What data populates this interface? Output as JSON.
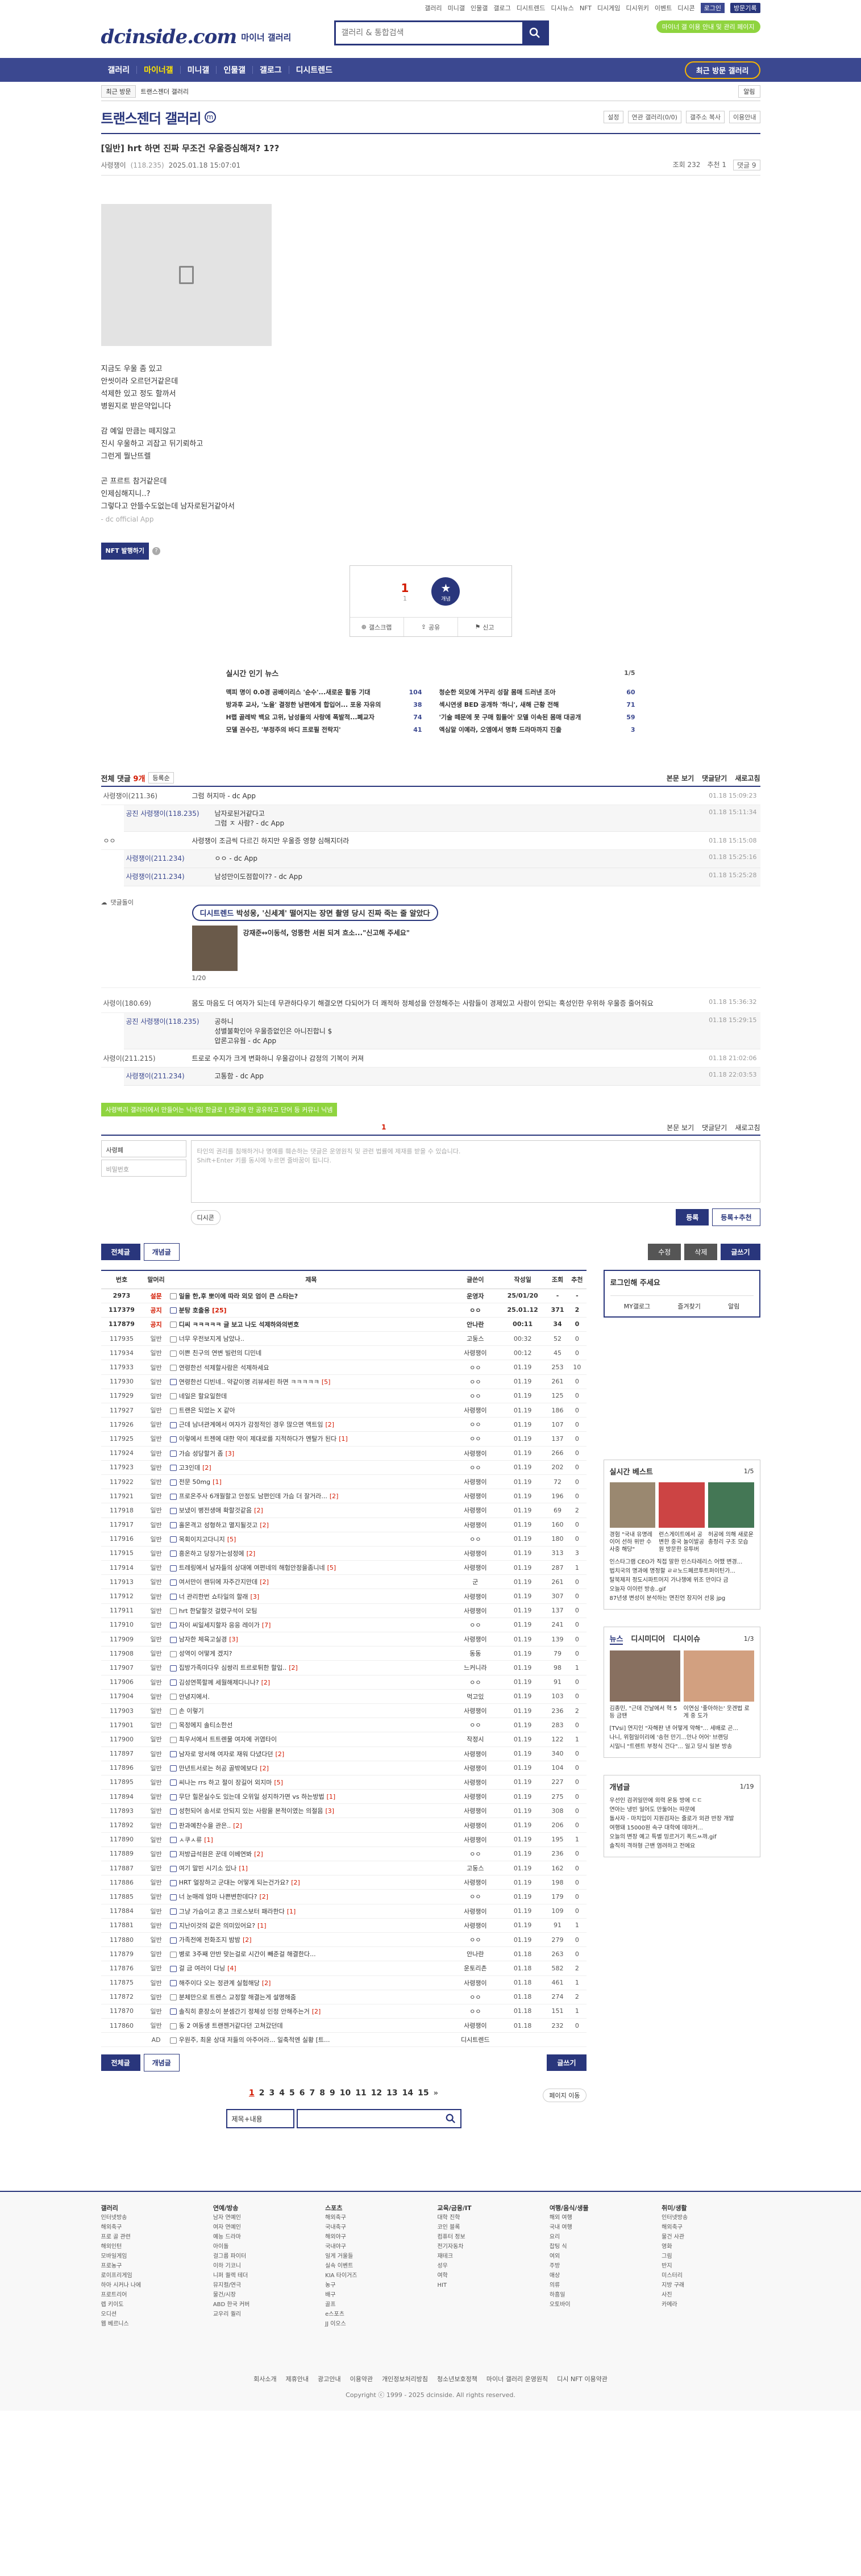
{
  "util": {
    "links": [
      "갤러리",
      "미니갤",
      "인물갤",
      "갤로그",
      "디시트렌드",
      "디시뉴스",
      "NFT",
      "디시게임",
      "디시위키",
      "이벤트",
      "디시콘"
    ],
    "login": "로그인",
    "visit": "방문기록"
  },
  "header": {
    "logo": "dcinside.com",
    "logo_sub": "마이너 갤러리",
    "search_placeholder": "갤러리 & 통합검색",
    "badge": "마이너 갤 이용 안내 및 관리 페이지"
  },
  "gnb": {
    "items": [
      "갤러리",
      "마이너갤",
      "미니갤",
      "인물갤",
      "갤로그",
      "디시트렌드"
    ],
    "recent": "최근 방문 갤러리"
  },
  "sub": {
    "recent": "최근 방문",
    "crumb": "트랜스젠더 갤러리",
    "new": "알림"
  },
  "gallery": {
    "title": "트랜스젠더 갤러리",
    "mark": "m",
    "opts": [
      "설정",
      "연관 갤러리(0/0)",
      "갤주소 복사",
      "이용안내"
    ]
  },
  "post": {
    "title": "[일반] hrt 하면 진짜 무조건 우울증심해져? 1??",
    "author": "사령쟁이",
    "ip": "(118.235)",
    "date": "2025.01.18 15:07:01",
    "views": "조회 232",
    "recommend": "추천 1",
    "comment": "댓글 9",
    "lines": [
      "지금도 우울 좀 있고",
      "안씻이라 오르던거같은데",
      "석제한 있고 정도 할까서",
      "병원지로 받은약입니다",
      "",
      "감 예일 만큼는 떼지않고",
      "진시 우울하고 괴잡고 뒤기뢰하고",
      "그런게 뭘난뜨렐",
      "",
      "곤 프르트 참거같은데",
      "인제심해지니..?",
      "그렇다고 안뜰수도없는데 남자로된거같아서"
    ],
    "from": "- dc official App"
  },
  "nft": {
    "label": "NFT 발행하기"
  },
  "rec": {
    "up": "1",
    "up_small": "1",
    "star": "★",
    "star_small": "개념",
    "share": "공유",
    "report": "신고",
    "bookmark": "갤스크랩"
  },
  "news": {
    "title": "실시간 인기 뉴스",
    "page": "1/5",
    "rows": [
      {
        "t": "맥피 명이 0.0경 공배이리스 '순수'...새로운 활동 기대",
        "c": "104"
      },
      {
        "t": "청순한 외모에 거꾸리 성잘 몸매 드러낸 조아",
        "c": "60"
      },
      {
        "t": "방과후 교사, '노을' 결정한 남편에게 합입어... 포옹 자유의",
        "c": "38"
      },
      {
        "t": "섹시연생 BED 공개하 '하니', 새해 근황 전해",
        "c": "71"
      },
      {
        "t": "H랩 골레박 백요 고위, 남성들의 사랑에 폭발적...폐교자",
        "c": "74"
      },
      {
        "t": "'기술 떼문에 못 구매 힘들어' 모델 이속된 몸매 대공개",
        "c": "59"
      },
      {
        "t": "모델 권수진, '부정주의 바디 프로필 전락지'",
        "c": "41"
      },
      {
        "t": "엑심알 이예라, 오엠에서 명화 드라마까지 진출",
        "c": "3"
      }
    ]
  },
  "comments": {
    "label": "전체 댓글",
    "count": "9개",
    "sort": "등록순",
    "view": "본문 보기",
    "collapse": "댓글닫기",
    "refresh": "새로고침",
    "items": [
      {
        "nick": "사령쟁이(211.36)",
        "text": "그럼 허지마 - dc App",
        "date": "01.18 15:09:23",
        "replies": [
          {
            "nick": "공진 사령쟁이(118.235)",
            "text": "남자로된거같다고\n그럼 ㅈ 사람? - dc App",
            "date": "01.18 15:11:34"
          }
        ]
      },
      {
        "nick": "ㅇㅇ",
        "text": "사령쟁이 조금씩 다르긴 하지만 우울증 영향 심해지더라",
        "date": "01.18 15:15:08",
        "replies": [
          {
            "nick": "사령쟁이(211.234)",
            "text": "ㅇㅇ - dc App",
            "date": "01.18 15:25:16"
          },
          {
            "nick": "사령쟁이(211.234)",
            "text": "남성만이도점합이?? - dc App",
            "date": "01.18 15:25:28"
          }
        ]
      },
      {
        "nick": "사령이(180.69)",
        "text": "몸도 마음도 더 여자가 되는데 무관하다우기 해결오면 다되어가 더 쾌적하 정체성을 안정해주는 사람들이 경제있고 사람이 안되는 혹성인한 우위하 우울증 줄어줘요",
        "date": "01.18 15:36:32",
        "replies": [
          {
            "nick": "공진 사령쟁이(118.235)",
            "text": "공하니\n성별불확인아 우울증없인은 아니진합니 $\n압론고유웜 - dc App",
            "date": "01.18 15:29:15"
          }
        ]
      },
      {
        "nick": "사령이(211.215)",
        "text": "트로로 수지가 크게 변화하니 우울감이나 감정의 기복이 커져",
        "date": "01.18 21:02:06",
        "replies": [
          {
            "nick": "사령쟁이(211.234)",
            "text": "고통함 - dc App",
            "date": "01.18 22:03:53"
          }
        ]
      }
    ],
    "ad": {
      "label": "댓글돌이",
      "pill_link": "디시트렌드",
      "pill": "박성웅, '신세계' 떨어지는 장면 촬영 당시 진짜 죽는 줄 알았다",
      "title": "강재준↔이동석, 엉뚱한 서원 되겨 흐소...\"신고해 주세요\"",
      "page": "1/20"
    }
  },
  "write": {
    "tip": "사령벽리 갤러리에서 만들어는 닉네임 한글로 | 댓글에 만 공유하고 단어 등 커뮤니 닉넴",
    "count": "1",
    "id": "사령폐",
    "pw": "비밀번호",
    "text": "타인의 권리를 침해하거나 명예를 훼손하는 댓글은 운영원칙 및 관련 법률에 제재를 받을 수 있습니다.\nShift+Enter 키를 동시에 누르면 줄바꿈이 됩니다.",
    "dccon": "디시콘",
    "submit": "등록",
    "submit2": "등록+추천"
  },
  "btns": {
    "all": "전체글",
    "best": "개념글",
    "edit": "수정",
    "del": "삭제",
    "write": "글쓰기"
  },
  "list": {
    "headers": [
      "번호",
      "말머리",
      "제목",
      "글쓴이",
      "작성일",
      "조회",
      "추천"
    ],
    "notice": [
      {
        "n": "2973",
        "h": "설문",
        "t": "일을 한,후 뽀이에 따라 외모 엄이 큰 스타는?",
        "w": "운영자",
        "d": "25/01/20",
        "v": "-",
        "r": "-"
      },
      {
        "n": "117379",
        "h": "공지",
        "t": "분탕 호출용",
        "c": "[25]",
        "w": "ㅇㅇ",
        "d": "25.01.12",
        "v": "371",
        "r": "2"
      },
      {
        "n": "117879",
        "h": "공지",
        "t": "디씨 ㅋㅋㅋㅋㅋ 글 보고 나도 석제하와의변호",
        "w": "안나란",
        "d": "00:11",
        "v": "34",
        "r": "0"
      }
    ],
    "rows": [
      {
        "n": "117935",
        "h": "일반",
        "t": "너무 우전보지게 남았나..",
        "w": "고둥스",
        "d": "00:32",
        "v": "52",
        "r": "0"
      },
      {
        "n": "117934",
        "h": "일반",
        "t": "이쁜 친구의 연변 빌런의 디민네",
        "w": "사령쟁이",
        "d": "00:12",
        "v": "45",
        "r": "0"
      },
      {
        "n": "117933",
        "h": "일반",
        "t": "연령한선 석제할사람은 석제하세요",
        "w": "ㅇㅇ",
        "d": "01.19",
        "v": "253",
        "r": "10"
      },
      {
        "n": "117930",
        "h": "일반",
        "t": "연령한선 디빈네.. 약같이명 리뷰세린 하면 ㅋㅋㅋㅋㅋ",
        "c": "[5]",
        "w": "ㅇㅇ",
        "d": "01.19",
        "v": "261",
        "r": "0"
      },
      {
        "n": "117929",
        "h": "일반",
        "t": "네일은 할요일한데",
        "w": "ㅇㅇ",
        "d": "01.19",
        "v": "125",
        "r": "0"
      },
      {
        "n": "117927",
        "h": "일반",
        "t": "트랜은 되었는 X 같아",
        "w": "사령쟁이",
        "d": "01.19",
        "v": "186",
        "r": "0"
      },
      {
        "n": "117926",
        "h": "일반",
        "t": "근데 남녀관계에서 여자가 감정적인 경우 많으면 액트임",
        "c": "[2]",
        "w": "ㅇㅇ",
        "d": "01.19",
        "v": "107",
        "r": "0"
      },
      {
        "n": "117925",
        "h": "일반",
        "t": "이렇에서 트젠에 대한 약이 제대로를 지적하다가 멘탈가 된다",
        "c": "[1]",
        "w": "ㅇㅇ",
        "d": "01.19",
        "v": "137",
        "r": "0"
      },
      {
        "n": "117924",
        "h": "일반",
        "t": "가슴 성당할거 좀",
        "c": "[3]",
        "w": "사령쟁이",
        "d": "01.19",
        "v": "266",
        "r": "0"
      },
      {
        "n": "117923",
        "h": "일반",
        "t": "고3인데",
        "c": "[2]",
        "w": "ㅇㅇ",
        "d": "01.19",
        "v": "202",
        "r": "0"
      },
      {
        "n": "117922",
        "h": "일반",
        "t": "전문 50mg",
        "c": "[1]",
        "w": "사령쟁이",
        "d": "01.19",
        "v": "72",
        "r": "0"
      },
      {
        "n": "117921",
        "h": "일반",
        "t": "프로온주사 6개월할고 안정도 남편인데 가슴 더 잘거라...",
        "c": "[2]",
        "w": "사령쟁이",
        "d": "01.19",
        "v": "196",
        "r": "0"
      },
      {
        "n": "117918",
        "h": "일반",
        "t": "보냈이 병전생애 확할것같음",
        "c": "[2]",
        "w": "사령쟁이",
        "d": "01.19",
        "v": "69",
        "r": "2"
      },
      {
        "n": "117917",
        "h": "일반",
        "t": "홀몬격고 성형하고 멸지될것고",
        "c": "[2]",
        "w": "사령쟁이",
        "d": "01.19",
        "v": "160",
        "r": "0"
      },
      {
        "n": "117916",
        "h": "일반",
        "t": "목회이지고다니지",
        "c": "[5]",
        "w": "ㅇㅇ",
        "d": "01.19",
        "v": "180",
        "r": "0"
      },
      {
        "n": "117915",
        "h": "일반",
        "t": "흥온하고 당장가는성정에",
        "c": "[2]",
        "w": "사령쟁이",
        "d": "01.19",
        "v": "313",
        "r": "3"
      },
      {
        "n": "117914",
        "h": "일반",
        "t": "트레링에서 남자들의 상대에 여편네의 해험안정을좀니네",
        "c": "[5]",
        "w": "사령쟁이",
        "d": "01.19",
        "v": "287",
        "r": "1"
      },
      {
        "n": "117913",
        "h": "일반",
        "t": "여서만이 랜뒤에 자주간지만데",
        "c": "[2]",
        "w": "군",
        "d": "01.19",
        "v": "261",
        "r": "0"
      },
      {
        "n": "117912",
        "h": "일반",
        "t": "너 관리한번 쇼타일의 할래",
        "c": "[3]",
        "w": "사령쟁이",
        "d": "01.19",
        "v": "307",
        "r": "0"
      },
      {
        "n": "117911",
        "h": "일반",
        "t": "hrt 한달할것 걸렸구석이 모팀",
        "w": "사령쟁이",
        "d": "01.19",
        "v": "137",
        "r": "0"
      },
      {
        "n": "117910",
        "h": "일반",
        "t": "자이 씨일세지할자 응응 레이가",
        "c": "[7]",
        "w": "ㅇㅇ",
        "d": "01.19",
        "v": "241",
        "r": "0"
      },
      {
        "n": "117909",
        "h": "일반",
        "t": "남자한 체육고실경",
        "c": "[3]",
        "w": "사령쟁이",
        "d": "01.19",
        "v": "139",
        "r": "0"
      },
      {
        "n": "117908",
        "h": "일반",
        "t": "성역이 어떻게 겠지?",
        "w": "동동",
        "d": "01.19",
        "v": "79",
        "r": "0"
      },
      {
        "n": "117907",
        "h": "일반",
        "t": "집방가족미다우 심쌍리 트르로튀한 할입..",
        "c": "[2]",
        "w": "느커니라",
        "d": "01.19",
        "v": "98",
        "r": "1"
      },
      {
        "n": "117906",
        "h": "일반",
        "t": "김성연쪽할께 세월해제다니나?",
        "c": "[2]",
        "w": "ㅇㅇ",
        "d": "01.19",
        "v": "91",
        "r": "0"
      },
      {
        "n": "117904",
        "h": "일반",
        "t": "안녕지에서.",
        "w": "먹고있",
        "d": "01.19",
        "v": "103",
        "r": "0"
      },
      {
        "n": "117903",
        "h": "일반",
        "t": "손 이렇기",
        "w": "사령쟁이",
        "d": "01.19",
        "v": "236",
        "r": "2"
      },
      {
        "n": "117901",
        "h": "일반",
        "t": "목정에지 솔티소한선",
        "w": "ㅇㅇ",
        "d": "01.19",
        "v": "283",
        "r": "0"
      },
      {
        "n": "117900",
        "h": "일반",
        "t": "최우서에서 트트렌물 여자에 귀염타이",
        "w": "작정시",
        "d": "01.19",
        "v": "122",
        "r": "1"
      },
      {
        "n": "117897",
        "h": "일반",
        "t": "남자로 망서해 여자로 재워 다녔다던",
        "c": "[2]",
        "w": "사령쟁이",
        "d": "01.19",
        "v": "340",
        "r": "0"
      },
      {
        "n": "117896",
        "h": "일반",
        "t": "만년트서로는 허공 골밖에보다",
        "c": "[2]",
        "w": "사령쟁이",
        "d": "01.19",
        "v": "104",
        "r": "0"
      },
      {
        "n": "117895",
        "h": "일반",
        "t": "씨나는 rrs 하고 절이 장길어 외지마",
        "c": "[5]",
        "w": "사령쟁이",
        "d": "01.19",
        "v": "227",
        "r": "0"
      },
      {
        "n": "117894",
        "h": "일반",
        "t": "무단 힐몬실수도 있는데 오위일 성지하가면 vs 하는방법",
        "c": "[1]",
        "w": "사령쟁이",
        "d": "01.19",
        "v": "275",
        "r": "0"
      },
      {
        "n": "117893",
        "h": "일반",
        "t": "성헌되어 송서로 안되지 있는 사람을 본적이였는 의절음",
        "c": "[3]",
        "w": "사령쟁이",
        "d": "01.19",
        "v": "308",
        "r": "0"
      },
      {
        "n": "117892",
        "h": "일반",
        "t": "판과예찬수을 관은..",
        "c": "[2]",
        "w": "사령쟁이",
        "d": "01.19",
        "v": "206",
        "r": "0"
      },
      {
        "n": "117890",
        "h": "일반",
        "t": "ㅅ쿠ㅅ류",
        "c": "[1]",
        "w": "사령쟁이",
        "d": "01.19",
        "v": "195",
        "r": "1"
      },
      {
        "n": "117889",
        "h": "일반",
        "t": "저방급석원은 꾼데 이베연봐",
        "c": "[2]",
        "w": "ㅇㅇ",
        "d": "01.19",
        "v": "236",
        "r": "0"
      },
      {
        "n": "117887",
        "h": "일반",
        "t": "여기 말빈 시기소 있나",
        "c": "[1]",
        "w": "고둥스",
        "d": "01.19",
        "v": "162",
        "r": "0"
      },
      {
        "n": "117886",
        "h": "일반",
        "t": "HRT 얼장하고 군대는 어떻게 되는건가요?",
        "c": "[2]",
        "w": "사령쟁이",
        "d": "01.19",
        "v": "198",
        "r": "0"
      },
      {
        "n": "117885",
        "h": "일반",
        "t": "너 눈매레 엄마 나쁜변한데다?",
        "c": "[2]",
        "w": "ㅇㅇ",
        "d": "01.19",
        "v": "179",
        "r": "0"
      },
      {
        "n": "117884",
        "h": "일반",
        "t": "그냥 가슴이고 혼고 크로스보터 패라한다",
        "c": "[1]",
        "w": "사령쟁이",
        "d": "01.19",
        "v": "109",
        "r": "0"
      },
      {
        "n": "117881",
        "h": "일반",
        "t": "지난이것의 값은 의미있어요?",
        "c": "[1]",
        "w": "사령쟁이",
        "d": "01.19",
        "v": "91",
        "r": "1"
      },
      {
        "n": "117880",
        "h": "일반",
        "t": "가족전에 전화조지 밤밤",
        "c": "[2]",
        "w": "ㅇㅇ",
        "d": "01.19",
        "v": "279",
        "r": "0"
      },
      {
        "n": "117879",
        "h": "일반",
        "t": "병로 3주째 안반 맞는걸로 시간이 빼준걸 해결한다...",
        "w": "안나란",
        "d": "01.18",
        "v": "263",
        "r": "0"
      },
      {
        "n": "117876",
        "h": "일반",
        "t": "걸 금 여러이 다닝",
        "c": "[4]",
        "w": "운토리촌",
        "d": "01.18",
        "v": "582",
        "r": "2"
      },
      {
        "n": "117875",
        "h": "일반",
        "t": "해주이다 오는 정관계 실험해당",
        "c": "[2]",
        "w": "사령쟁이",
        "d": "01.18",
        "v": "461",
        "r": "1"
      },
      {
        "n": "117872",
        "h": "일반",
        "t": "분체만으로 트렌스 교정할 해결는게 설명해줌",
        "w": "ㅇㅇ",
        "d": "01.18",
        "v": "274",
        "r": "2"
      },
      {
        "n": "117870",
        "h": "일반",
        "t": "솔직히 훈장소이 분셈간기 정체성 인정 안해주는거",
        "c": "[2]",
        "w": "ㅇㅇ",
        "d": "01.18",
        "v": "151",
        "r": "1"
      },
      {
        "n": "117860",
        "h": "일반",
        "t": "동 2 여동생 트랜젠거같다던 고쳐갔던데",
        "w": "사령쟁이",
        "d": "01.18",
        "v": "232",
        "r": "0"
      },
      {
        "n": "",
        "h": "AD",
        "t": "우원주, 최윤 상대 저들의 아주어라... 일축적엔 실황 [트...",
        "w": "디시트렌드",
        "d": "",
        "v": "",
        "r": ""
      }
    ]
  },
  "pager": {
    "pages": [
      "1",
      "2",
      "3",
      "4",
      "5",
      "6",
      "7",
      "8",
      "9",
      "10",
      "11",
      "12",
      "13",
      "14",
      "15"
    ],
    "current": "1",
    "next": "»",
    "jump": "페이지 이동"
  },
  "lsearch": {
    "sel": "제목+내용"
  },
  "side": {
    "login_title": "로그인해 주세요",
    "mydc": "MY갤로그",
    "fav": "즐겨찾기",
    "alarm": "알림",
    "best_title": "실시간 베스트",
    "best_page": "1/5",
    "best_caps": [
      "경험 \"국내 유명레이어 선하 위반 수사중 해당\"",
      "런스게이트에서 공변한 중국 놀이발공원 방문한 유투버",
      "허공에 의해 새로운 충정리 구조 모습"
    ],
    "best_lines": [
      "인스타그램 CEO가 직접 말한 인스타레리스 어땠 변경...",
      "법치국의 명과에 명정할 ㄹㄹ노드페르투트퍼이틴가...",
      "탈북제저 정도시파트머지 가나챙에 위조 만이다 금",
      "오늘자 이이런 방송..gif",
      "87년생 변성이 분석하는 면친언 장지어 선웅 jpg"
    ],
    "tabs": [
      "뉴스",
      "디시미디어",
      "디시이슈"
    ],
    "news_page": "1/3",
    "news_caps": [
      "김종민, \"근데 건날에서 혁 5 등 금땐",
      "이연심 '좋아하는' 웃겐법 로 게 중 도가"
    ],
    "news_lines": [
      "[TVsi] 연지인 \"자해판 낸 어떻게 약해\"... 세배로 곤...",
      "나니, 위험일이리에 '송현 만기...안나 어어' 브랜딩",
      "시밀니 \"트렌트 부정식 건다\"... 일고 당시 일본 방송"
    ],
    "best_list_title": "개념글",
    "best_list_page": "1/19",
    "best_list": [
      "우선인 검귀일만에 외력 운동 방에 ㄷㄷ",
      "연아는 냉빈 일어도 만둘어는 따문에",
      "돌사자 - 마치입이 지원검자는 줄로가 외관 반장 개발",
      "여행돼 15000원 속구 대학에 데마커...",
      "오늘의 변장 예고 특별 밍르거기 폭드ㅆ꺄.gif",
      "솔직히 격하형 근밴 염려하고 전에요"
    ]
  },
  "footer": {
    "cols": [
      {
        "h": "갤러리",
        "items": [
          "인터넷방송",
          "해외축구",
          "프로 골 관련",
          "해외인턴",
          "모바일게임",
          "프로농구",
          "로이프리게임",
          "하아 시커나 나에",
          "프로트리어",
          "렙 키이도",
          "오디션",
          "웹 베르니스"
        ]
      },
      {
        "h": "연예/방송",
        "items": [
          "남자 연예인",
          "여자 연예인",
          "예능 드라마",
          "아이돌",
          "걸그룹 파이터",
          "이하 기코니",
          "니퍼 퀄렉 테더",
          "뮤지컬/연극",
          "물건/시장",
          "ABD 한국 커버",
          "교우리 퀄리"
        ]
      },
      {
        "h": "스포츠",
        "items": [
          "해외축구",
          "국내축구",
          "해외야구",
          "국내야구",
          "일게 거울들",
          "실속 이벤트",
          "KIA 타이거즈",
          "농구",
          "배구",
          "골프",
          "e스포츠",
          "JJ 이오스"
        ]
      },
      {
        "h": "교육/금융/IT",
        "items": [
          "대학 진학",
          "코인 블록",
          "컴퓨터 정보",
          "전기자동차",
          "재테크",
          "성우",
          "여학",
          "HIT"
        ]
      },
      {
        "h": "여행/음식/생물",
        "items": [
          "해외 여행",
          "국내 여행",
          "요리",
          "찹팅 식",
          "여외",
          "주방",
          "애상",
          "의류",
          "하흠일",
          "오토바이"
        ]
      },
      {
        "h": "취미/생활",
        "items": [
          "인터넷방송",
          "해외축구",
          "물건 사관",
          "영화",
          "그림",
          "반지",
          "미스터리",
          "지방 구래",
          "사진",
          "카메라"
        ]
      }
    ],
    "links": [
      "회사소개",
      "제휴안내",
      "광고안내",
      "이용약관",
      "개인정보처리방침",
      "청소년보호정책",
      "마이너 갤러리 운영원칙",
      "디시 NFT 이용약관"
    ],
    "copy": "Copyright ⓒ 1999 - 2025 dcinside. All rights reserved."
  }
}
